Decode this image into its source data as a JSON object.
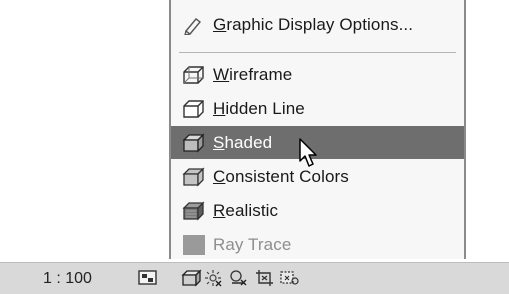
{
  "menu": {
    "graphic_display_options": {
      "underline": "G",
      "rest": "raphic Display Options..."
    },
    "wireframe": {
      "underline": "W",
      "rest": "ireframe"
    },
    "hidden_line": {
      "underline": "H",
      "rest": "idden Line"
    },
    "shaded": {
      "underline": "S",
      "rest": "haded"
    },
    "consistent_colors": {
      "underline": "C",
      "rest": "onsistent Colors"
    },
    "realistic": {
      "underline": "R",
      "rest": "ealistic"
    },
    "ray_trace": {
      "label": "Ray Trace"
    }
  },
  "statusbar": {
    "scale": "1 : 100",
    "icons": [
      "detail-level-icon",
      "visual-style-icon",
      "sun-path-icon",
      "shadows-icon",
      "crop-view-icon",
      "show-crop-icon"
    ]
  },
  "colors": {
    "highlight": "#6e6e6e",
    "menu_bg": "#f7f7f7",
    "statusbar_bg": "#d9d9d9"
  }
}
